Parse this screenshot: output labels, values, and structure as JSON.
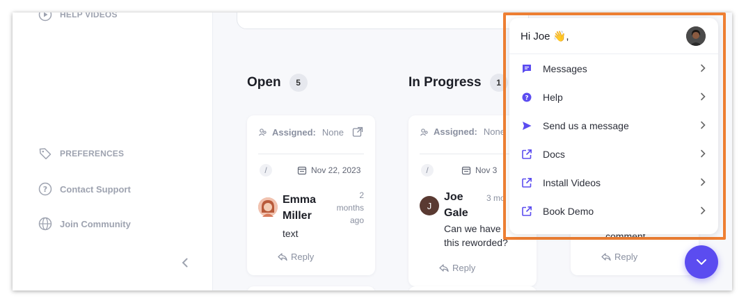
{
  "sidebar": {
    "help_videos": "HELP VIDEOS",
    "preferences": "PREFERENCES",
    "contact_support": "Contact Support",
    "join_community": "Join Community"
  },
  "columns": [
    {
      "title": "Open",
      "count": "5"
    },
    {
      "title": "In Progress",
      "count": "1"
    }
  ],
  "cards": [
    {
      "assigned_label": "Assigned:",
      "assigned_value": "None",
      "slash": "/",
      "date": "Nov 22, 2023",
      "author_line1": "Emma",
      "author_line2": "Miller",
      "ago_line1": "2",
      "ago_line2": "months",
      "ago_line3": "ago",
      "text": "text",
      "reply": "Reply"
    },
    {
      "assigned_label": "Assigned:",
      "assigned_value": "None",
      "slash": "/",
      "date": "Nov 3",
      "author_initial": "J",
      "author_line1": "Joe",
      "author_line2": "Gale",
      "ago_line1": "3 mo",
      "text_line1": "Can we have",
      "text_line2": "this reworded?",
      "reply": "Reply"
    },
    {
      "partial_text": "comment",
      "reply": "Reply"
    }
  ],
  "popup": {
    "greeting": "Hi Joe 👋,",
    "items": [
      {
        "label": "Messages",
        "icon": "message-icon"
      },
      {
        "label": "Help",
        "icon": "help-icon"
      },
      {
        "label": "Send us a message",
        "icon": "send-icon"
      },
      {
        "label": "Docs",
        "icon": "external-link-icon"
      },
      {
        "label": "Install Videos",
        "icon": "external-link-icon"
      },
      {
        "label": "Book Demo",
        "icon": "external-link-icon"
      }
    ]
  },
  "colors": {
    "accent": "#5b4cf0",
    "highlight_border": "#ee7f33",
    "muted": "#9ea3b0"
  }
}
